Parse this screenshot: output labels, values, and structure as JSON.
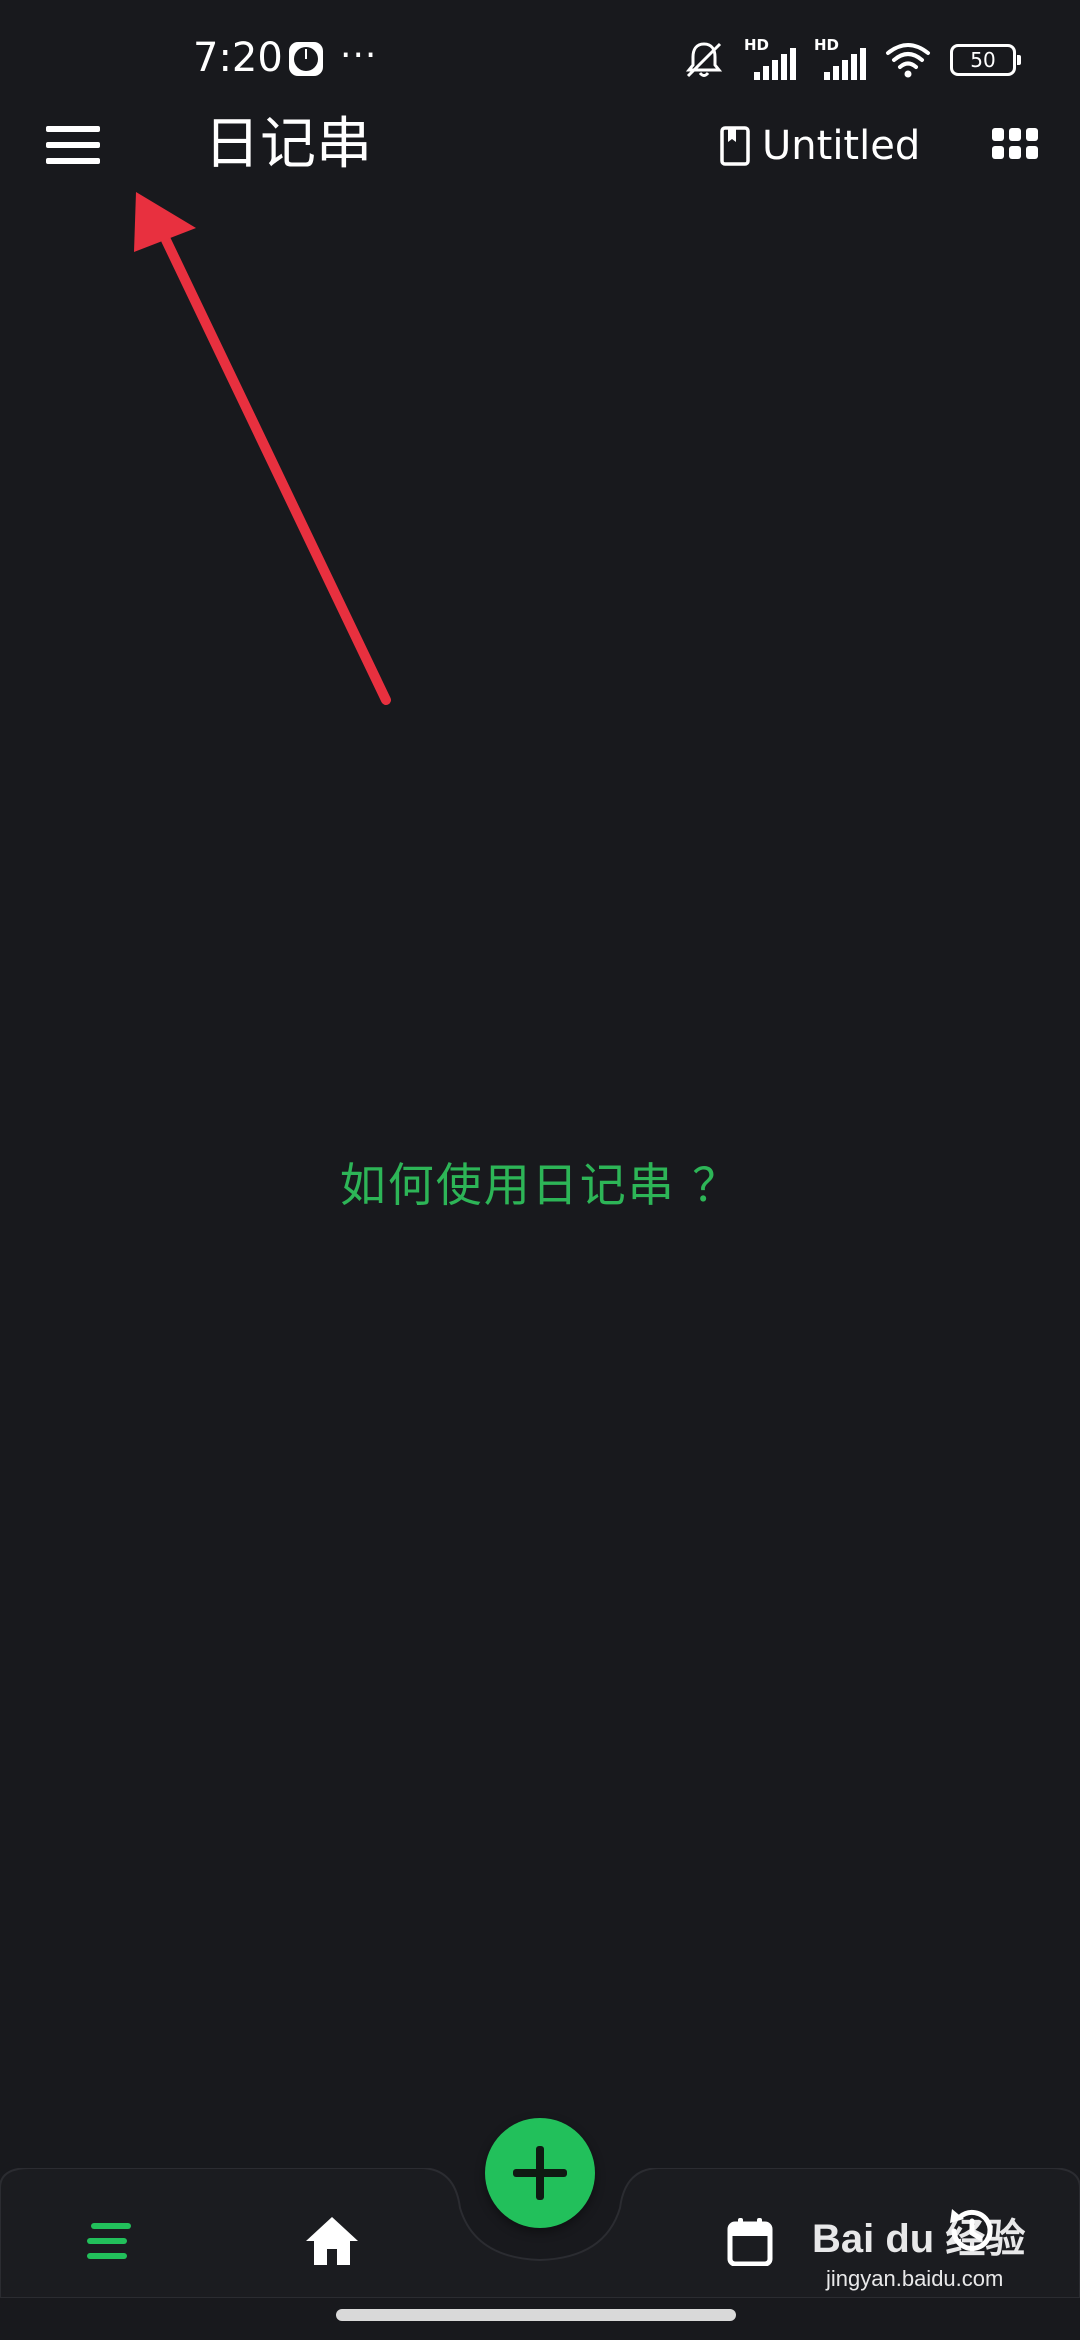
{
  "status_bar": {
    "time": "7:20",
    "dots": "···",
    "hd_1": "HD",
    "hd_2": "HD",
    "battery": "50"
  },
  "header": {
    "title": "日记串",
    "notebook_name": "Untitled"
  },
  "main": {
    "help_link": "如何使用日记串 ？"
  },
  "watermark": {
    "brand": "Bai du 经验",
    "url": "jingyan.baidu.com"
  },
  "colors": {
    "background": "#18191d",
    "accent": "#22c05b",
    "help_text": "#2db557",
    "annotation_arrow": "#e8303f"
  },
  "icons": {
    "menu": "hamburger-menu-icon",
    "notebook": "notebook-icon",
    "apps": "grid-apps-icon",
    "nav_list": "list-icon",
    "nav_home": "home-icon",
    "nav_add": "plus-icon",
    "nav_calendar": "calendar-icon",
    "nav_history": "history-icon"
  }
}
